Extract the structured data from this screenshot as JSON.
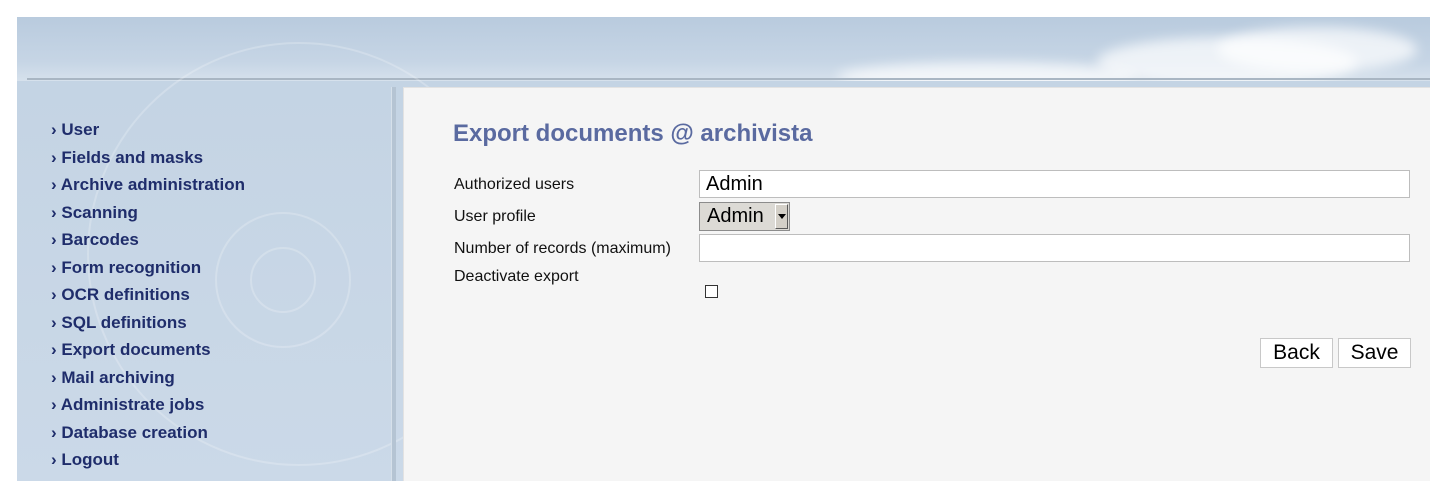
{
  "sidebar": {
    "items": [
      {
        "label": "› User"
      },
      {
        "label": "› Fields and masks"
      },
      {
        "label": "› Archive administration"
      },
      {
        "label": "› Scanning"
      },
      {
        "label": "› Barcodes"
      },
      {
        "label": "› Form recognition"
      },
      {
        "label": "› OCR definitions"
      },
      {
        "label": "› SQL definitions"
      },
      {
        "label": "› Export documents"
      },
      {
        "label": "› Mail archiving"
      },
      {
        "label": "› Administrate jobs"
      },
      {
        "label": "› Database creation"
      },
      {
        "label": "› Logout"
      }
    ]
  },
  "main": {
    "title": "Export documents @ archivista",
    "form": {
      "authorized_users": {
        "label": "Authorized users",
        "value": "Admin"
      },
      "user_profile": {
        "label": "User profile",
        "selected": "Admin"
      },
      "max_records": {
        "label": "Number of records (maximum)",
        "value": ""
      },
      "deactivate_export": {
        "label": "Deactivate export",
        "checked": false
      }
    },
    "buttons": {
      "back": "Back",
      "save": "Save"
    }
  },
  "colors": {
    "nav_text": "#1f2d6b",
    "title_text": "#5a6aa0",
    "content_bg": "#f5f5f5",
    "frame_bg": "#c3d3e3"
  }
}
